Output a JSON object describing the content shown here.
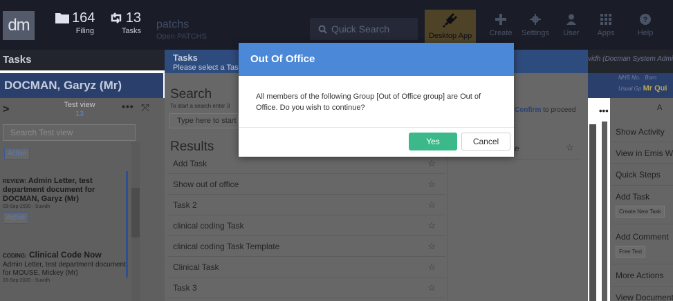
{
  "topbar": {
    "logo": "dm",
    "filing": {
      "count": "164",
      "label": "Filing"
    },
    "tasks": {
      "count": "13",
      "label": "Tasks"
    },
    "brand": {
      "name": "patchs",
      "sub": "Open PATCHS"
    },
    "search_placeholder": "Quick Search",
    "buttons": [
      {
        "label": "Desktop App"
      },
      {
        "label": "Create"
      },
      {
        "label": "Settings"
      },
      {
        "label": "User"
      },
      {
        "label": "Apps"
      },
      {
        "label": "Help"
      }
    ]
  },
  "left": {
    "header": "Tasks",
    "patient": "DOCMAN, Garyz (Mr)",
    "view_title": "Test view",
    "view_count": "13",
    "search_placeholder": "Search Test view",
    "top_tag": "Active",
    "cards": [
      {
        "label": "REVIEW:",
        "title": "Admin Letter, test department document for DOCMAN, Garyz (Mr)",
        "meta": "03-Sep-2020 - Suvidh",
        "tag": "Active"
      },
      {
        "label": "CODING:",
        "title": "Clinical Code Now",
        "desc": "Admin Letter, test department document for MOUSE, Mickey (Mr)",
        "meta": "03-Sep-2020 - Suvidh"
      }
    ]
  },
  "tasks_modal": {
    "title": "Tasks",
    "subtitle": "Please select a Task",
    "search_label": "Search",
    "search_hint": "To start a search enter 3",
    "search_placeholder": "Type here to start",
    "results_label": "Results",
    "results": [
      "Add Task",
      "Show out of office",
      "Task 2",
      "clinical coding Task",
      "clinical coding Task Template",
      "Clinical Task",
      "Task 3"
    ],
    "confirm_bold": "Confirm",
    "confirm_rest": " to proceed",
    "selected_letter": "e"
  },
  "right": {
    "admin_text": "vidh (Docman System Admi",
    "nhs_label": "NHS No.",
    "born_label": "Born",
    "usual_gp_label": "Usual Gp",
    "usual_gp_value": "Mr Qui",
    "items": [
      "Show Activity",
      "View in Emis We",
      "Quick Steps",
      "Add Task",
      "Add Comment",
      "More Actions",
      "View Documents"
    ],
    "chips": [
      "Create New Task",
      "Free Text"
    ]
  },
  "dialog": {
    "title": "Out Of Office",
    "message": "All members of the following Group [Out of Office group] are Out of Office. Do you wish to continue?",
    "yes_label": "Yes",
    "cancel_label": "Cancel"
  },
  "colors": {
    "dialog_header": "#4b89d8",
    "yes_button": "#3bb98a",
    "topbar": "#1a1d28"
  }
}
